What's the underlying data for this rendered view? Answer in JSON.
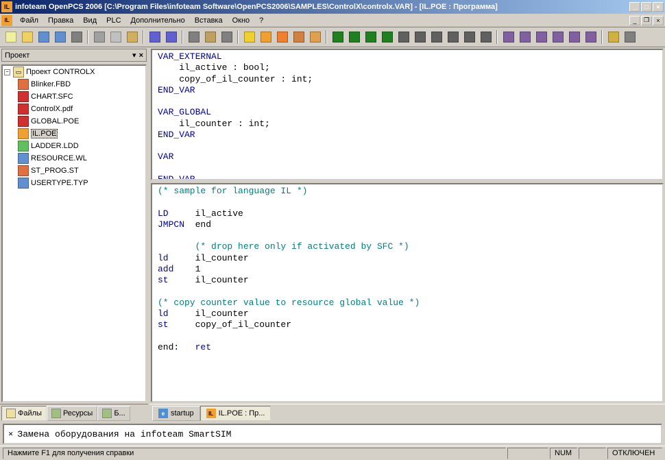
{
  "title": "infoteam OpenPCS 2006 [C:\\Program Files\\infoteam Software\\OpenPCS2006\\SAMPLES\\ControlX\\controlx.VAR]  - [IL.POE : Программа]",
  "app_icon": "IL",
  "menu": [
    "Файл",
    "Правка",
    "Вид",
    "PLC",
    "Дополнительно",
    "Вставка",
    "Окно",
    "?"
  ],
  "sidebar": {
    "title": "Проект",
    "root": "Проект CONTROLX",
    "items": [
      {
        "label": "Blinker.FBD",
        "icon_color": "#e07040"
      },
      {
        "label": "CHART.SFC",
        "icon_color": "#d03030"
      },
      {
        "label": "ControlX.pdf",
        "icon_color": "#d03030"
      },
      {
        "label": "GLOBAL.POE",
        "icon_color": "#d03030"
      },
      {
        "label": "IL.POE",
        "icon_color": "#f0a030",
        "selected": true
      },
      {
        "label": "LADDER.LDD",
        "icon_color": "#60c060"
      },
      {
        "label": "RESOURCE.WL",
        "icon_color": "#6090d0"
      },
      {
        "label": "ST_PROG.ST",
        "icon_color": "#e07040"
      },
      {
        "label": "USERTYPE.TYP",
        "icon_color": "#6090d0"
      }
    ],
    "tabs": [
      {
        "label": "Файлы",
        "active": true
      },
      {
        "label": "Ресурсы"
      },
      {
        "label": "Б..."
      }
    ]
  },
  "code_top": [
    {
      "t": "VAR_EXTERNAL",
      "c": "kw-blue"
    },
    {
      "t": "    il_active : bool;",
      "c": "txt-black"
    },
    {
      "t": "    copy_of_il_counter : int;",
      "c": "txt-black"
    },
    {
      "t": "END_VAR",
      "c": "kw-blue"
    },
    {
      "t": "",
      "c": ""
    },
    {
      "t": "VAR_GLOBAL",
      "c": "kw-blue"
    },
    {
      "t": "    il_counter : int;",
      "c": "txt-black"
    },
    {
      "t": "END_VAR",
      "c": "kw-blue"
    },
    {
      "t": "",
      "c": ""
    },
    {
      "t": "VAR",
      "c": "kw-blue"
    },
    {
      "t": "",
      "c": ""
    },
    {
      "t": "END_VAR",
      "c": "kw-blue"
    }
  ],
  "code_bottom_lines": [
    [
      {
        "t": "(* sample for language IL *)",
        "c": "kw-teal"
      }
    ],
    [
      {
        "t": "",
        "c": ""
      }
    ],
    [
      {
        "t": "LD     ",
        "c": "kw-blue"
      },
      {
        "t": "il_active",
        "c": "txt-black"
      }
    ],
    [
      {
        "t": "JMPCN  ",
        "c": "kw-blue"
      },
      {
        "t": "end",
        "c": "txt-black"
      }
    ],
    [
      {
        "t": "",
        "c": ""
      }
    ],
    [
      {
        "t": "       (* drop here only if activated by SFC *)",
        "c": "kw-teal"
      }
    ],
    [
      {
        "t": "ld     ",
        "c": "kw-blue"
      },
      {
        "t": "il_counter",
        "c": "txt-black"
      }
    ],
    [
      {
        "t": "add    ",
        "c": "kw-blue"
      },
      {
        "t": "1",
        "c": "txt-black"
      }
    ],
    [
      {
        "t": "st     ",
        "c": "kw-blue"
      },
      {
        "t": "il_counter",
        "c": "txt-black"
      }
    ],
    [
      {
        "t": "",
        "c": ""
      }
    ],
    [
      {
        "t": "(* copy counter value to resource global value *)",
        "c": "kw-teal"
      }
    ],
    [
      {
        "t": "ld     ",
        "c": "kw-blue"
      },
      {
        "t": "il_counter",
        "c": "txt-black"
      }
    ],
    [
      {
        "t": "st     ",
        "c": "kw-blue"
      },
      {
        "t": "copy_of_il_counter",
        "c": "txt-black"
      }
    ],
    [
      {
        "t": "",
        "c": ""
      }
    ],
    [
      {
        "t": "end:   ",
        "c": "txt-black"
      },
      {
        "t": "ret",
        "c": "kw-blue"
      }
    ]
  ],
  "editor_tabs": [
    {
      "label": "startup",
      "icon": "e"
    },
    {
      "label": "IL.POE : Пр...",
      "icon": "IL",
      "active": true
    }
  ],
  "output": "Замена оборудования на infoteam SmartSIM",
  "status": {
    "help": "Нажмите F1 для получения справки",
    "num": "NUM",
    "conn": "ОТКЛЮЧЕН"
  },
  "toolbar_icons": [
    "new",
    "open",
    "save",
    "saveall",
    "print",
    "|",
    "cut",
    "copy",
    "paste",
    "|",
    "undo",
    "redo",
    "|",
    "zoom",
    "find",
    "goto",
    "|",
    "build",
    "buildall",
    "rebuild",
    "compile",
    "check",
    "|",
    "run",
    "step",
    "stepover",
    "stepinto",
    "pause",
    "stop",
    "restart",
    "continue",
    "up",
    "down",
    "|",
    "tool1",
    "tool2",
    "tool3",
    "tool4",
    "tool5",
    "tool6",
    "|",
    "layout",
    "close"
  ],
  "toolbar_colors": {
    "new": "#f0f0a0",
    "open": "#f0d060",
    "save": "#6090d0",
    "saveall": "#6090d0",
    "print": "#808080",
    "cut": "#a0a0a0",
    "copy": "#c0c0c0",
    "paste": "#d0b060",
    "undo": "#6060d0",
    "redo": "#6060d0",
    "zoom": "#808080",
    "find": "#c0a060",
    "goto": "#808080",
    "build": "#f0d030",
    "buildall": "#f0a030",
    "rebuild": "#f08030",
    "compile": "#d08040",
    "check": "#e0a050",
    "run": "#208020",
    "step": "#208020",
    "stepover": "#208020",
    "stepinto": "#208020",
    "pause": "#606060",
    "stop": "#606060",
    "restart": "#606060",
    "continue": "#606060",
    "up": "#606060",
    "down": "#606060",
    "tool1": "#8060a0",
    "tool2": "#8060a0",
    "tool3": "#8060a0",
    "tool4": "#8060a0",
    "tool5": "#8060a0",
    "tool6": "#8060a0",
    "layout": "#d0b040",
    "close": "#808080"
  }
}
